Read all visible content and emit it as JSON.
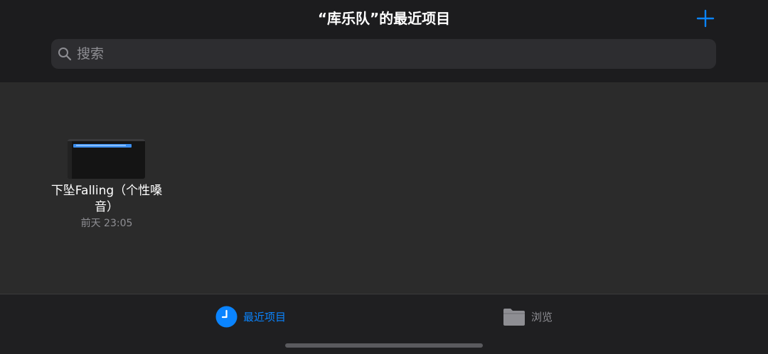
{
  "header": {
    "title": "“库乐队”的最近项目",
    "add_icon": "plus-icon",
    "accent_color": "#0a84ff"
  },
  "search": {
    "placeholder": "搜索",
    "value": "",
    "icon": "search-icon"
  },
  "projects": [
    {
      "name": "下坠Falling（个性嗓音）",
      "date": "前天 23:05"
    }
  ],
  "tabbar": {
    "recent_label": "最近项目",
    "recent_icon": "clock-icon",
    "browse_label": "浏览",
    "browse_icon": "folder-icon",
    "active_tab": "recent"
  }
}
